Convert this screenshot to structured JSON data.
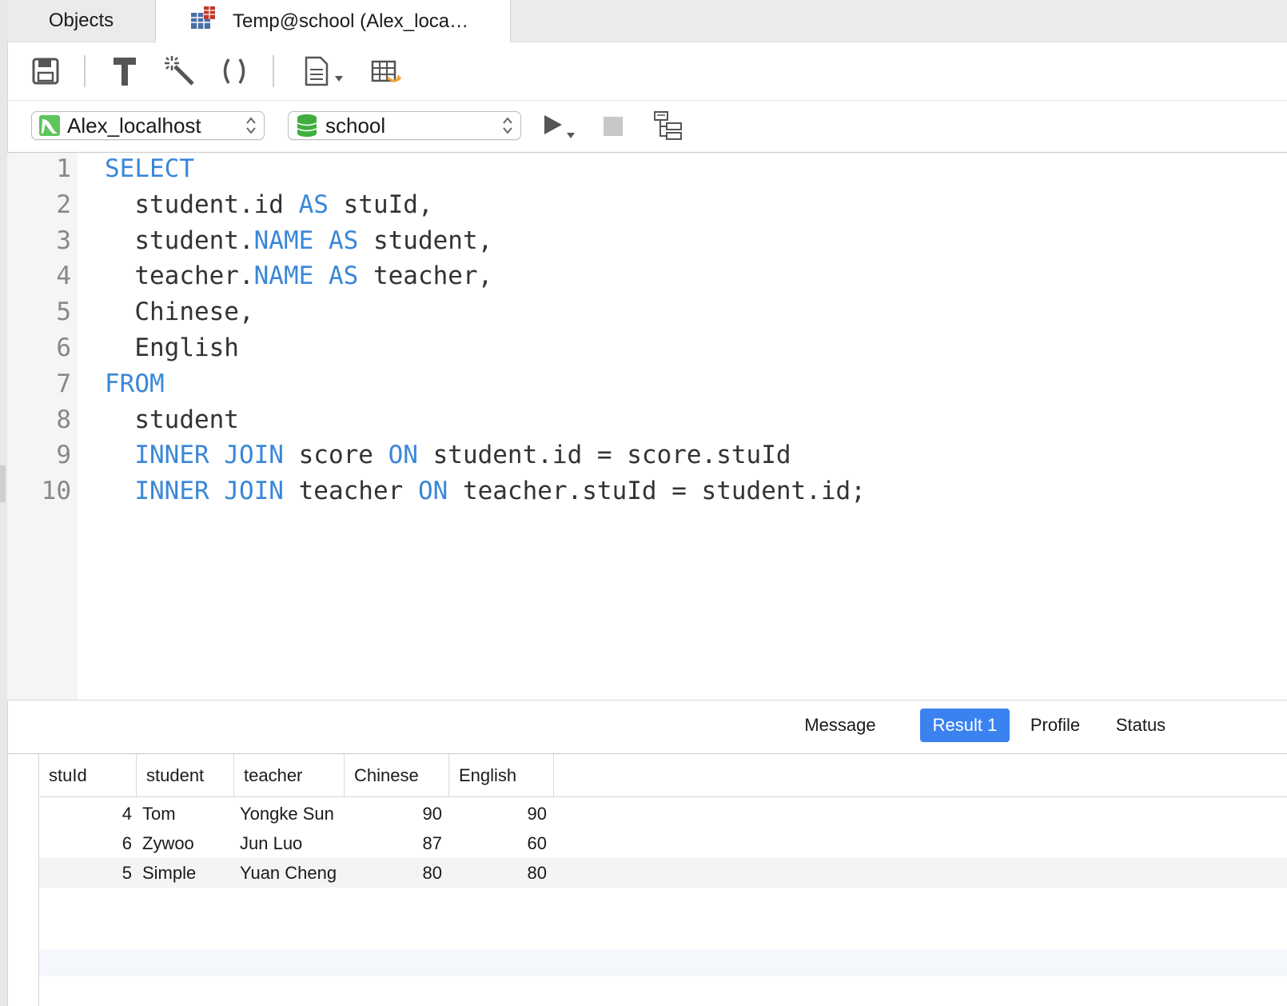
{
  "tabs": {
    "objects_label": "Objects",
    "query_label": "Temp@school (Alex_loca…"
  },
  "toolbar": {
    "icons": [
      "save-icon",
      "format-hammer-icon",
      "beautify-wand-icon",
      "parentheses-icon",
      "document-dropdown-icon",
      "table-export-icon"
    ]
  },
  "connection": {
    "server": "Alex_localhost",
    "database": "school",
    "accent_green": "#5cc55c"
  },
  "editor": {
    "line_numbers": [
      "1",
      "2",
      "3",
      "4",
      "5",
      "6",
      "7",
      "8",
      "9",
      "10"
    ],
    "lines": [
      [
        {
          "t": "SELECT",
          "kw": true
        }
      ],
      [
        {
          "t": "  student.id "
        },
        {
          "t": "AS",
          "kw": true
        },
        {
          "t": " stuId,"
        }
      ],
      [
        {
          "t": "  student."
        },
        {
          "t": "NAME",
          "kw": true
        },
        {
          "t": " "
        },
        {
          "t": "AS",
          "kw": true
        },
        {
          "t": " student,"
        }
      ],
      [
        {
          "t": "  teacher."
        },
        {
          "t": "NAME",
          "kw": true
        },
        {
          "t": " "
        },
        {
          "t": "AS",
          "kw": true
        },
        {
          "t": " teacher,"
        }
      ],
      [
        {
          "t": "  Chinese,"
        }
      ],
      [
        {
          "t": "  English"
        }
      ],
      [
        {
          "t": "FROM",
          "kw": true
        }
      ],
      [
        {
          "t": "  student"
        }
      ],
      [
        {
          "t": "  "
        },
        {
          "t": "INNER JOIN",
          "kw": true
        },
        {
          "t": " score "
        },
        {
          "t": "ON",
          "kw": true
        },
        {
          "t": " student.id = score.stuId"
        }
      ],
      [
        {
          "t": "  "
        },
        {
          "t": "INNER JOIN",
          "kw": true
        },
        {
          "t": " teacher "
        },
        {
          "t": "ON",
          "kw": true
        },
        {
          "t": " teacher.stuId = student.id;"
        }
      ]
    ],
    "keyword_color": "#3a87d8"
  },
  "result_tabs": {
    "message": "Message",
    "result1": "Result 1",
    "profile": "Profile",
    "status": "Status",
    "active_color": "#3b82f1"
  },
  "grid": {
    "columns": [
      "stuId",
      "student",
      "teacher",
      "Chinese",
      "English"
    ],
    "rows": [
      [
        "4",
        "Tom",
        "Yongke Sun",
        "90",
        "90"
      ],
      [
        "6",
        "Zywoo",
        "Jun Luo",
        "87",
        "60"
      ],
      [
        "5",
        "Simple",
        "Yuan Cheng",
        "80",
        "80"
      ]
    ]
  }
}
